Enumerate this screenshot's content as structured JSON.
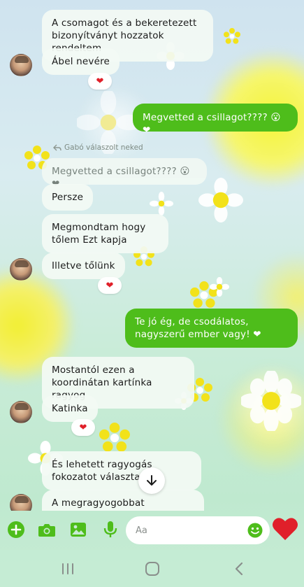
{
  "colors": {
    "accent": "#4ebd1b",
    "incoming_bubble": "#f3faf4",
    "heart": "#e0202a"
  },
  "messages": [
    {
      "id": "m1",
      "direction": "in",
      "text": "A csomagot és a bekeretezett bizonyítványt hozzatok rendeltem"
    },
    {
      "id": "m2",
      "direction": "in",
      "text": "Ábel nevére",
      "reaction": "❤"
    },
    {
      "id": "m3",
      "direction": "out",
      "text": "Megvetted a csillagot???? 😮 ❤"
    },
    {
      "id": "m4",
      "direction": "in",
      "reply_label": "Gabó válaszolt neked",
      "quoted": "Megvetted a csillagot???? 😮 ❤"
    },
    {
      "id": "m5",
      "direction": "in",
      "text": "Persze"
    },
    {
      "id": "m6",
      "direction": "in",
      "text": "Megmondtam hogy tőlem Ezt kapja"
    },
    {
      "id": "m7",
      "direction": "in",
      "text": "Illetve tőlünk",
      "reaction": "❤"
    },
    {
      "id": "m8",
      "direction": "out",
      "text": "Te jó ég, de csodálatos, nagyszerű ember vagy! ❤"
    },
    {
      "id": "m9",
      "direction": "in",
      "text": "Mostantól ezen a koordinátan kartínka ragyog"
    },
    {
      "id": "m10",
      "direction": "in",
      "text": "Katinka",
      "reaction": "❤"
    },
    {
      "id": "m11",
      "direction": "in",
      "text": "És lehetett ragyogás fokozatot választani"
    },
    {
      "id": "m12",
      "direction": "in",
      "text": "A megragyogobbat választottam"
    }
  ],
  "input": {
    "placeholder": "Aa",
    "icons": [
      "plus-icon",
      "camera-icon",
      "gallery-icon",
      "microphone-icon",
      "emoji-icon",
      "heart-send-icon"
    ]
  },
  "navbar": {
    "icons": [
      "recent-apps-icon",
      "home-icon",
      "back-icon"
    ]
  }
}
